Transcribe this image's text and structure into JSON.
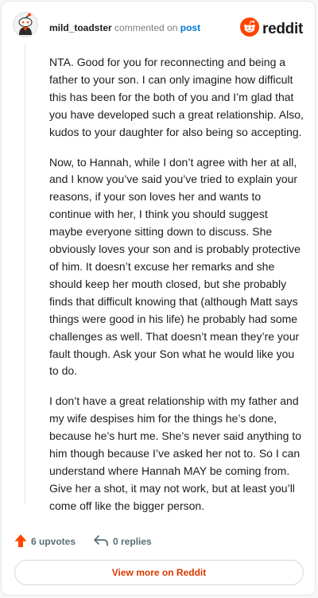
{
  "header": {
    "username": "mild_toadster",
    "action_text": "commented on",
    "post_link": "post",
    "brand_name": "reddit",
    "brand_color": "#ff4500"
  },
  "comment": {
    "paragraphs": [
      "NTA. Good for you for reconnecting and being a father to your son. I can only imagine how difficult this has been for the both of you and I’m glad that you have developed such a great relationship. Also, kudos to your daughter for also being so accepting.",
      "Now, to Hannah, while I don’t agree with her at all, and I know you’ve said you’ve tried to explain your reasons, if your son loves her and wants to continue with her, I think you should suggest maybe everyone sitting down to discuss. She obviously loves your son and is probably protective of him. It doesn’t excuse her remarks and she should keep her mouth closed, but she probably finds that difficult knowing that (although Matt says things were good in his life) he probably had some challenges as well. That doesn’t mean they’re your fault though. Ask your Son what he would like you to do.",
      "I don’t have a great relationship with my father and my wife despises him for the things he’s done, because he’s hurt me. She’s never said anything to him though because I’ve asked her not to. So I can understand where Hannah MAY be coming from. Give her a shot, it may not work, but at least you’ll come off like the bigger person."
    ]
  },
  "footer": {
    "upvotes_label": "6 upvotes",
    "replies_label": "0 replies",
    "view_more_label": "View more on Reddit",
    "upvote_color": "#ff4500",
    "view_more_color": "#d93a00"
  },
  "icons": {
    "avatar": "snoo-avatar-icon",
    "brand": "reddit-logo-icon",
    "upvote": "upvote-arrow-icon",
    "reply": "reply-arrow-icon"
  }
}
